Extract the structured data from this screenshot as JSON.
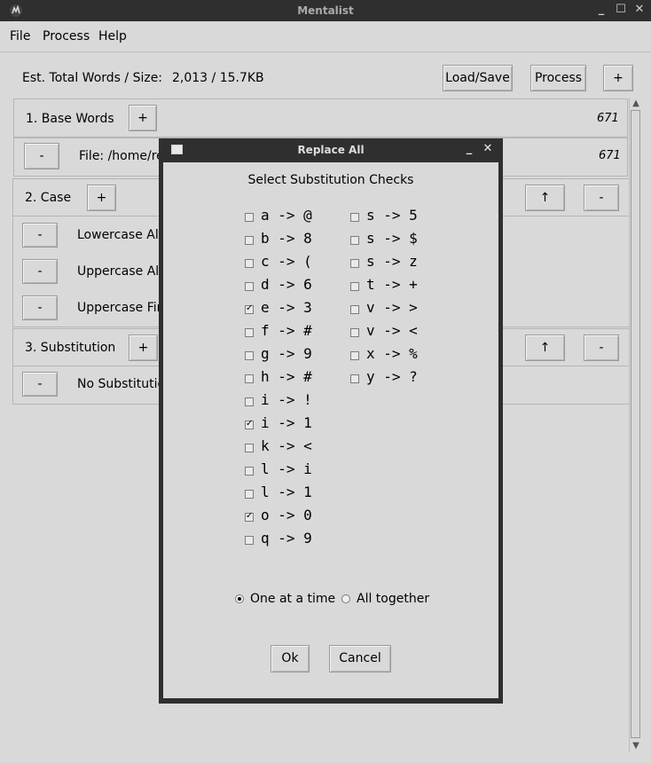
{
  "app": {
    "title": "Mentalist",
    "window_controls": [
      "_",
      "☐",
      "✕"
    ]
  },
  "menu": [
    "File",
    "Process",
    "Help"
  ],
  "toolbar": {
    "est_label": "Est. Total Words / Size:",
    "est_value": "2,013 / 15.7KB",
    "load_save": "Load/Save",
    "process": "Process",
    "add": "+"
  },
  "sections": [
    {
      "title": "1. Base Words",
      "add": "+",
      "count": "671",
      "rows": [
        {
          "remove": "-",
          "label": "File: /home/re",
          "count": "671"
        }
      ]
    },
    {
      "title": "2. Case",
      "add": "+",
      "up": "↑",
      "remove": "-",
      "rows": [
        {
          "remove": "-",
          "label": "Lowercase All"
        },
        {
          "remove": "-",
          "label": "Uppercase All"
        },
        {
          "remove": "-",
          "label": "Uppercase Firs"
        }
      ]
    },
    {
      "title": "3. Substitution",
      "add": "+",
      "up": "↑",
      "remove": "-",
      "rows": [
        {
          "remove": "-",
          "label": "No Substitutio"
        }
      ]
    }
  ],
  "dialog": {
    "title": "Replace All",
    "controls": [
      "_",
      "✕"
    ],
    "heading": "Select Substitution Checks",
    "left_checks": [
      {
        "label": "a -> @",
        "checked": false
      },
      {
        "label": "b -> 8",
        "checked": false
      },
      {
        "label": "c -> (",
        "checked": false
      },
      {
        "label": "d -> 6",
        "checked": false
      },
      {
        "label": "e -> 3",
        "checked": true
      },
      {
        "label": "f -> #",
        "checked": false
      },
      {
        "label": "g -> 9",
        "checked": false
      },
      {
        "label": "h -> #",
        "checked": false
      },
      {
        "label": "i -> !",
        "checked": false
      },
      {
        "label": "i -> 1",
        "checked": true
      },
      {
        "label": "k -> <",
        "checked": false
      },
      {
        "label": "l -> i",
        "checked": false
      },
      {
        "label": "l -> 1",
        "checked": false
      },
      {
        "label": "o -> 0",
        "checked": true
      },
      {
        "label": "q -> 9",
        "checked": false
      }
    ],
    "right_checks": [
      {
        "label": "s -> 5",
        "checked": false
      },
      {
        "label": "s -> $",
        "checked": false
      },
      {
        "label": "s -> z",
        "checked": false
      },
      {
        "label": "t -> +",
        "checked": false
      },
      {
        "label": "v -> >",
        "checked": false
      },
      {
        "label": "v -> <",
        "checked": false
      },
      {
        "label": "x -> %",
        "checked": false
      },
      {
        "label": "y -> ?",
        "checked": false
      }
    ],
    "mode_options": [
      {
        "label": "One at a time",
        "selected": true
      },
      {
        "label": "All together",
        "selected": false
      }
    ],
    "ok": "Ok",
    "cancel": "Cancel"
  }
}
